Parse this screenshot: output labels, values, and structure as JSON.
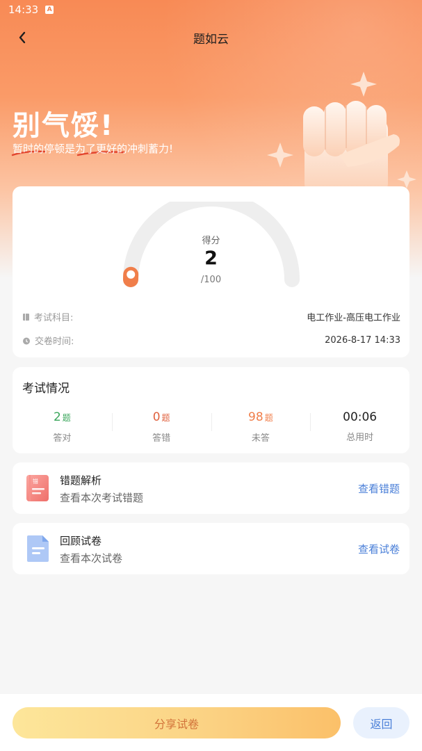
{
  "status_bar": {
    "time": "14:33",
    "indicator": "A"
  },
  "navbar": {
    "title": "题如云"
  },
  "encouragement": {
    "title": "别气馁!",
    "subtitle": "暂时的停顿是为了更好的冲刺蓄力!"
  },
  "score": {
    "label": "得分",
    "value": "2",
    "total": "/100",
    "fraction": 0.02
  },
  "exam_info": {
    "subject_label": "考试科目:",
    "subject_value": "电工作业-高压电工作业",
    "time_label": "交卷时间:",
    "time_value": "2026-8-17 14:33"
  },
  "stats": {
    "title": "考试情况",
    "items": [
      {
        "value": "2",
        "unit": "题",
        "label": "答对"
      },
      {
        "value": "0",
        "unit": "题",
        "label": "答错"
      },
      {
        "value": "98",
        "unit": "题",
        "label": "未答"
      },
      {
        "value": "00:06",
        "unit": "",
        "label": "总用时"
      }
    ]
  },
  "actions": {
    "wrong": {
      "title": "错题解析",
      "subtitle": "查看本次考试错题",
      "link": "查看错题",
      "icon_text": "错"
    },
    "review": {
      "title": "回顾试卷",
      "subtitle": "查看本次试卷",
      "link": "查看试卷"
    }
  },
  "bottom": {
    "share": "分享试卷",
    "return": "返回"
  },
  "colors": {
    "accent": "#f88a55",
    "correct": "#3aa65b",
    "wrong": "#e0623f",
    "unanswered": "#f07e4a",
    "link": "#4a7fd8"
  }
}
